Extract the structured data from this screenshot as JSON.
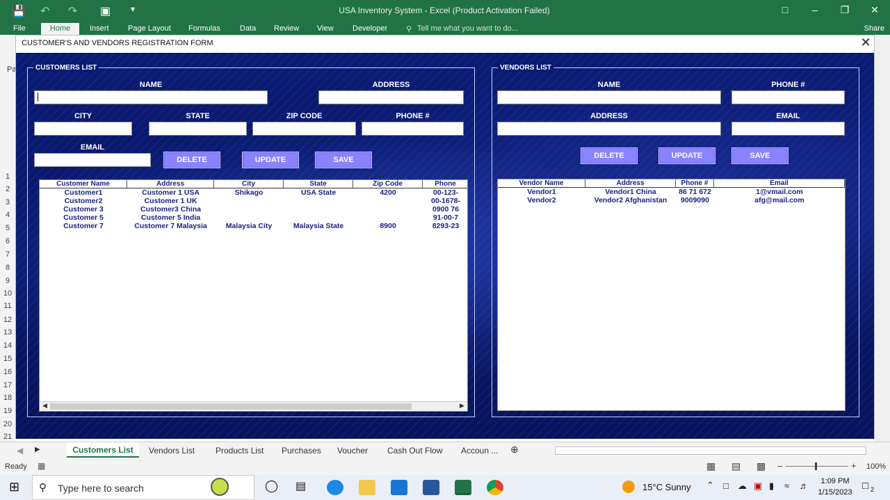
{
  "window": {
    "title": "USA Inventory System - Excel (Product Activation Failed)"
  },
  "ribbon": {
    "tabs": [
      "File",
      "Home",
      "Insert",
      "Page Layout",
      "Formulas",
      "Data",
      "Review",
      "View",
      "Developer"
    ],
    "tell_me": "Tell me what you want to do...",
    "share": "Share",
    "clip_label": "Pa"
  },
  "row_numbers": [
    "1",
    "2",
    "3",
    "4",
    "5",
    "6",
    "7",
    "8",
    "9",
    "10",
    "11",
    "12",
    "13",
    "14",
    "15",
    "16",
    "17",
    "18",
    "19",
    "20",
    "21"
  ],
  "dialog": {
    "title": "CUSTOMER'S AND VENDORS REGISTRATION FORM",
    "customers": {
      "group_label": "CUSTOMERS LIST",
      "labels": {
        "name": "NAME",
        "address": "ADDRESS",
        "city": "CITY",
        "state": "STATE",
        "zip": "ZIP CODE",
        "phone": "PHONE #",
        "email": "EMAIL"
      },
      "buttons": {
        "delete": "DELETE",
        "update": "UPDATE",
        "save": "SAVE"
      },
      "columns": [
        "Customer Name",
        "Address",
        "City",
        "State",
        "Zip Code",
        "Phone"
      ],
      "rows": [
        [
          "Customer1",
          "Customer 1  USA",
          "Shikago",
          "USA State",
          "4200",
          "00-123-"
        ],
        [
          "Customer2",
          "Customer 1  UK",
          "",
          "",
          "",
          "00-1678-"
        ],
        [
          "Customer 3",
          "Customer3 China",
          "",
          "",
          "",
          "0900 76"
        ],
        [
          "Customer 5",
          "Customer 5 India",
          "",
          "",
          "",
          "91-00-7"
        ],
        [
          "Customer 7",
          "Customer 7 Malaysia",
          "Malaysia City",
          "Malaysia State",
          "8900",
          "8293-23"
        ]
      ]
    },
    "vendors": {
      "group_label": "VENDORS LIST",
      "labels": {
        "name": "NAME",
        "phone": "PHONE #",
        "address": "ADDRESS",
        "email": "EMAIL"
      },
      "buttons": {
        "delete": "DELETE",
        "update": "UPDATE",
        "save": "SAVE"
      },
      "columns": [
        "Vendor Name",
        "Address",
        "Phone #",
        "Email"
      ],
      "rows": [
        [
          "Vendor1",
          "Vendor1 China",
          "86 71 672",
          "1@vmail.com"
        ],
        [
          "Vendor2",
          "Vendor2 Afghanistan",
          "9009090",
          "afg@mail.com"
        ]
      ]
    }
  },
  "sheet_tabs": [
    "Customers List",
    "Vendors List",
    "Products List",
    "Purchases",
    "Voucher",
    "Cash Out Flow",
    "Accoun ..."
  ],
  "status": {
    "ready": "Ready",
    "zoom": "100%"
  },
  "taskbar": {
    "search_placeholder": "Type here to search",
    "weather": "15°C  Sunny",
    "time": "1:09 PM",
    "date": "1/15/2023",
    "notifications": "2"
  }
}
